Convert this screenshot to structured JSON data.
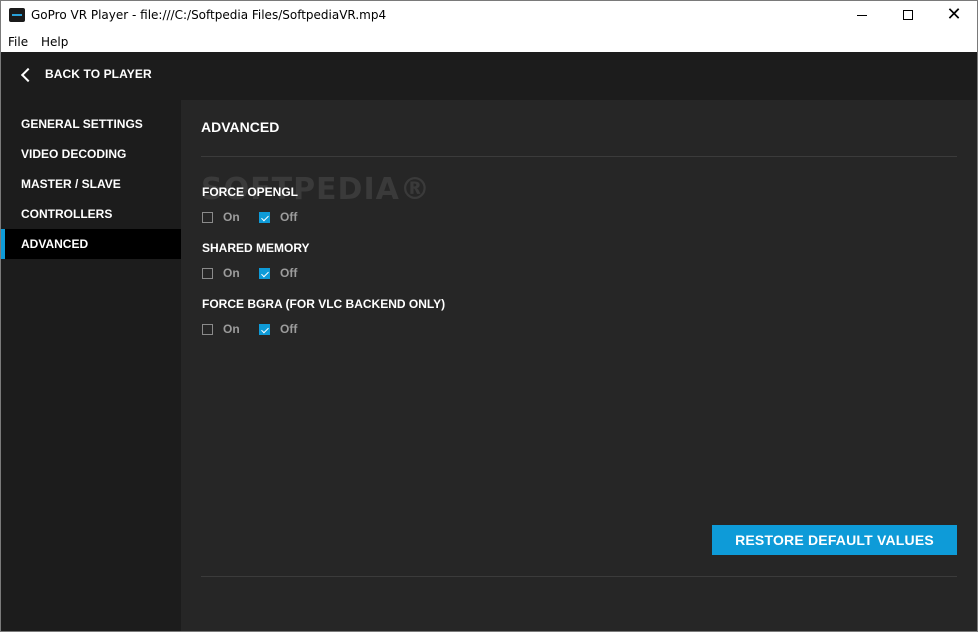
{
  "window": {
    "title": "GoPro VR Player - file:///C:/Softpedia Files/SoftpediaVR.mp4",
    "minimize": "",
    "maximize": "",
    "close": "✕"
  },
  "menu": {
    "file": "File",
    "help": "Help"
  },
  "header": {
    "back_label": "BACK TO PLAYER"
  },
  "sidebar": {
    "items": [
      {
        "label": "GENERAL SETTINGS"
      },
      {
        "label": "VIDEO DECODING"
      },
      {
        "label": "MASTER / SLAVE"
      },
      {
        "label": "CONTROLLERS"
      },
      {
        "label": "ADVANCED"
      }
    ],
    "active": "ADVANCED"
  },
  "main": {
    "title": "ADVANCED",
    "watermark": "SOFTPEDIA®",
    "settings": [
      {
        "label": "FORCE OPENGL",
        "on": "On",
        "off": "Off",
        "value": "Off"
      },
      {
        "label": "SHARED MEMORY",
        "on": "On",
        "off": "Off",
        "value": "Off"
      },
      {
        "label": "FORCE BGRA (FOR VLC BACKEND ONLY)",
        "on": "On",
        "off": "Off",
        "value": "Off"
      }
    ],
    "restore_label": "RESTORE DEFAULT VALUES"
  },
  "colors": {
    "accent": "#0e9bd8",
    "sidebar_bg": "#1c1c1c",
    "panel_bg": "#262626",
    "active_bg": "#000000"
  }
}
